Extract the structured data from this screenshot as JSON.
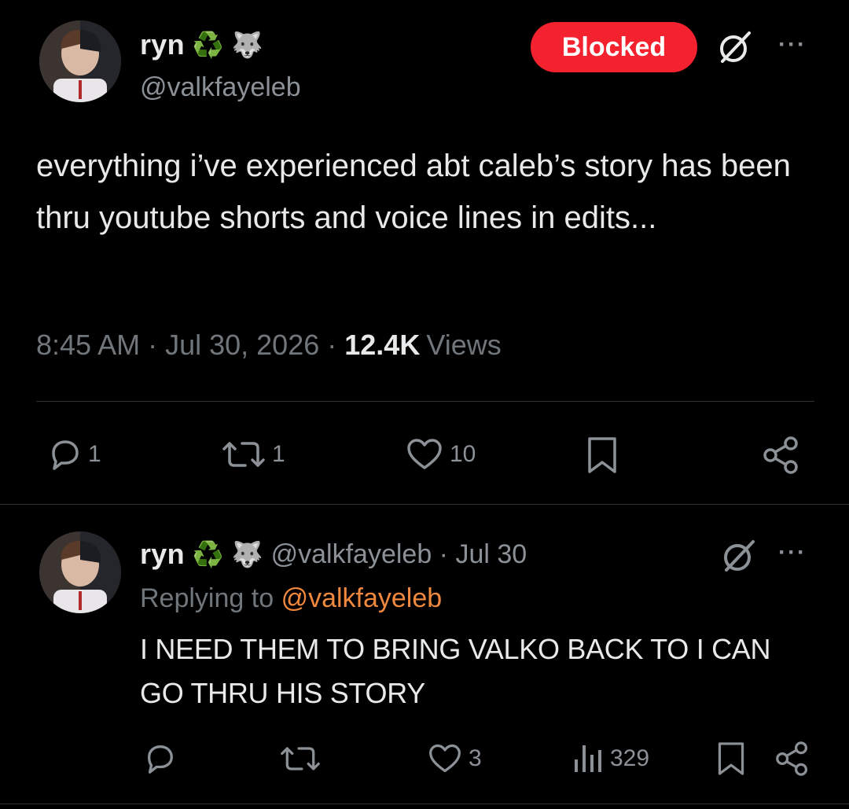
{
  "main_tweet": {
    "author": {
      "display_name": "ryn",
      "emoji_1": "♻️",
      "emoji_2": "🐺",
      "handle": "@valkfayeleb"
    },
    "blocked_label": "Blocked",
    "text": "everything i’ve experienced abt caleb’s story has been thru youtube shorts and voice lines in edits...",
    "time": "8:45 AM",
    "date": "Jul 30, 2026",
    "separator": "·",
    "views_count": "12.4K",
    "views_label": "Views",
    "actions": {
      "replies": "1",
      "reposts": "1",
      "likes": "10"
    }
  },
  "reply_tweet": {
    "author": {
      "display_name": "ryn",
      "emoji_1": "♻️",
      "emoji_2": "🐺",
      "handle_date": "@valkfayeleb · Jul 30"
    },
    "replying_to_label": "Replying to",
    "replying_to_handle": "@valkfayeleb",
    "text": "I NEED THEM TO BRING VALKO BACK TO I CAN GO THRU HIS STORY",
    "actions": {
      "likes": "3",
      "views": "329"
    }
  },
  "more_glyph": "···",
  "colors": {
    "background": "#000000",
    "text_primary": "#e7e9ea",
    "text_secondary": "#71767b",
    "blocked_red": "#f4212e",
    "link_orange": "#f0883e",
    "divider": "#2f3336"
  }
}
